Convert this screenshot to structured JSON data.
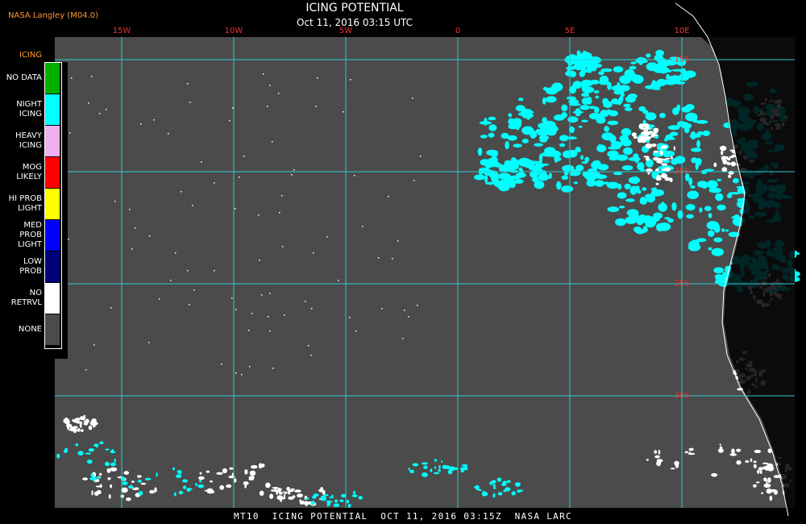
{
  "credit": "NASA Langley (M04.0)",
  "title": "ICING POTENTIAL",
  "subtitle": "Oct 11, 2016 03:15 UTC",
  "footer": "MT10  ICING POTENTIAL  OCT 11, 2016 03:15Z  NASA LARC",
  "legend": {
    "heading": "ICING",
    "items": [
      {
        "label": "NO DATA",
        "color": "#00b000"
      },
      {
        "label": "NIGHT\nICING",
        "color": "#00ffff"
      },
      {
        "label": "HEAVY\nICING",
        "color": "#f0b0f0"
      },
      {
        "label": "MOG\nLIKELY",
        "color": "#ff0000"
      },
      {
        "label": "HI PROB\nLIGHT",
        "color": "#ffff00"
      },
      {
        "label": "MED PROB\nLIGHT",
        "color": "#0000ff"
      },
      {
        "label": "LOW\nPROB",
        "color": "#00007a"
      },
      {
        "label": "NO\nRETRVL",
        "color": "#ffffff"
      },
      {
        "label": "NONE",
        "color": "#4b4b4b"
      }
    ]
  },
  "grid": {
    "longitudes": [
      {
        "label": "15W",
        "value": -15
      },
      {
        "label": "10W",
        "value": -10
      },
      {
        "label": "5W",
        "value": -5
      },
      {
        "label": "0",
        "value": 0
      },
      {
        "label": "5E",
        "value": 5
      },
      {
        "label": "10E",
        "value": 10
      }
    ],
    "latitudes": [
      {
        "label": "15S",
        "value": -15
      },
      {
        "label": "20S",
        "value": -20
      },
      {
        "label": "25S",
        "value": -25
      },
      {
        "label": "30S",
        "value": -30
      }
    ]
  },
  "colors": {
    "background": "#000000",
    "ocean": "#4b4b4b",
    "grid": "#30c8d0",
    "grid_label": "#e03030",
    "credit": "#ff9a2e",
    "icing": "#00ffff",
    "no_retrieval": "#ffffff"
  }
}
